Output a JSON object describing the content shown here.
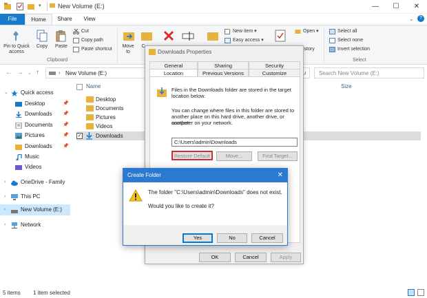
{
  "window": {
    "title": "New Volume (E:)"
  },
  "ribbon_tabs": [
    "File",
    "Home",
    "Share",
    "View"
  ],
  "ribbon": {
    "pin": "Pin to Quick\naccess",
    "copy": "Copy",
    "paste": "Paste",
    "cut": "Cut",
    "copy_path": "Copy path",
    "paste_shortcut": "Paste shortcut",
    "clipboard": "Clipboard",
    "move_to": "Move\nto",
    "copy_to": "C",
    "new_item": "New item",
    "easy_access": "Easy access",
    "open": "Open",
    "history": "istory",
    "select_all": "Select all",
    "select_none": "Select none",
    "invert_selection": "Invert selection",
    "select": "Select"
  },
  "address": {
    "path": "New Volume (E:)",
    "search_placeholder": "Search New Volume (E:)"
  },
  "nav": {
    "quick_access": "Quick access",
    "desktop": "Desktop",
    "downloads": "Downloads",
    "documents": "Documents",
    "pictures": "Pictures",
    "downloads2": "Downloads",
    "music": "Music",
    "videos": "Videos",
    "onedrive": "OneDrive - Family",
    "this_pc": "This PC",
    "new_volume": "New Volume (E:)",
    "network": "Network"
  },
  "content": {
    "col_name": "Name",
    "col_size": "Size",
    "rows": [
      "Desktop",
      "Documents",
      "Pictures",
      "Videos",
      "Downloads"
    ]
  },
  "status": {
    "items": "5 items",
    "selected": "1 item selected"
  },
  "props": {
    "title": "Downloads Properties",
    "tabs_top": [
      "General",
      "Sharing",
      "Security"
    ],
    "tabs_bottom": [
      "Location",
      "Previous Versions",
      "Customize"
    ],
    "info1": "Files in the Downloads folder are stored in the target",
    "info1b": "location below.",
    "info2": "You can change where files in this folder are stored to",
    "info2b": "another place on this hard drive, another drive, or another",
    "info2c": "computer on your network.",
    "path": "C:\\Users\\admin\\Downloads",
    "restore": "Restore Default",
    "move": "Move...",
    "find_target": "Find Target...",
    "ok": "OK",
    "cancel": "Cancel",
    "apply": "Apply"
  },
  "create_folder": {
    "title": "Create Folder",
    "message": "The folder \"C:\\Users\\admin\\Downloads\" does not exist.",
    "question": "Would you like to create it?",
    "yes": "Yes",
    "no": "No",
    "cancel": "Cancel"
  },
  "colors": {
    "accent": "#2b79d0",
    "file_tab": "#1979ca",
    "folder": "#e8b23c",
    "highlight": "#d62b2b"
  }
}
